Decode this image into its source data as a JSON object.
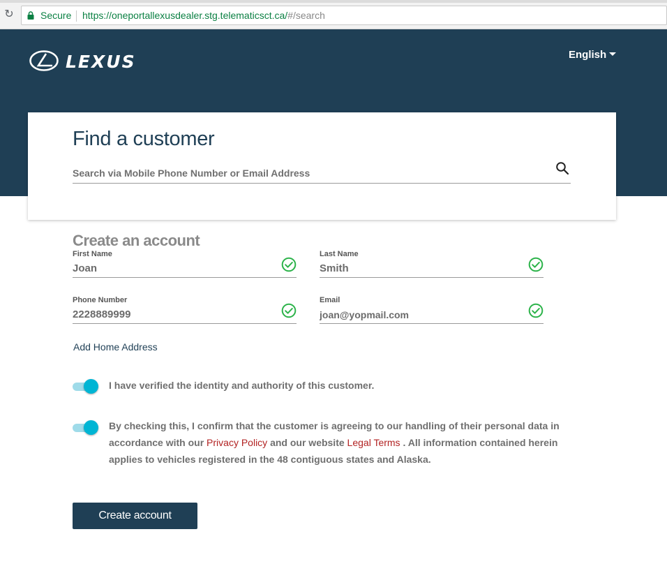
{
  "browser": {
    "security_label": "Secure",
    "url_host": "https://oneportallexusdealer.stg.telematicsct.ca/",
    "url_path": "#/search"
  },
  "header": {
    "logo_text": "LEXUS",
    "language": "English"
  },
  "search": {
    "title": "Find a customer",
    "placeholder": "Search via Mobile Phone Number or Email Address",
    "value": ""
  },
  "create_account": {
    "title": "Create an account",
    "fields": {
      "first_name": {
        "label": "First Name",
        "value": "Joan"
      },
      "last_name": {
        "label": "Last Name",
        "value": "Smith"
      },
      "phone": {
        "label": "Phone Number",
        "value": "2228889999"
      },
      "email": {
        "label": "Email",
        "value": "joan@yopmail.com"
      }
    },
    "add_address_label": "Add Home Address",
    "verify_toggle": {
      "checked": true,
      "text": "I have verified the identity and authority of this customer."
    },
    "consent_toggle": {
      "checked": true,
      "text_before": "By checking this, I confirm that the customer is agreeing to our handling of their personal data in accordance with our ",
      "privacy_link": "Privacy Policy",
      "text_middle": " and our website ",
      "legal_link": "Legal Terms",
      "text_after": " . All information contained herein applies to vehicles registered in the 48 contiguous states and Alaska."
    },
    "submit_label": "Create account"
  },
  "colors": {
    "brand_navy": "#1f3f55",
    "toggle_on": "#00b5d4",
    "check_green": "#2cb34a",
    "link_red": "#b22222"
  },
  "icons": {
    "reload": "reload-icon",
    "lock": "lock-icon",
    "search": "search-icon",
    "validated": "check-circle-icon",
    "language_caret": "caret-down-icon"
  }
}
